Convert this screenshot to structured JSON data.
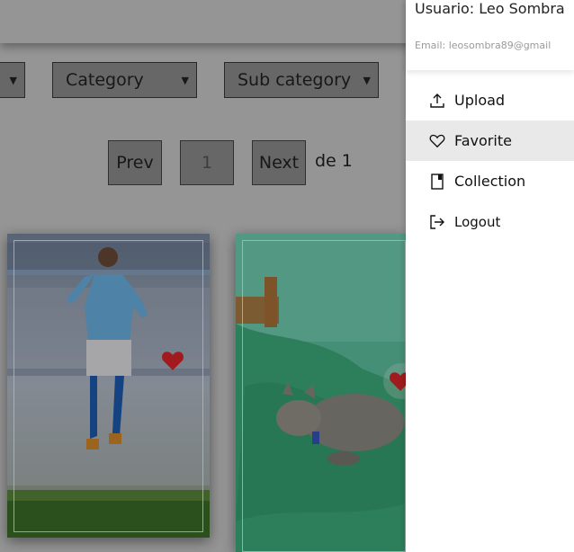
{
  "filters": {
    "first_select_value": "",
    "category_label": "Category",
    "subcategory_label": "Sub category"
  },
  "pagination": {
    "prev_label": "Prev",
    "page_number": "1",
    "next_label": "Next",
    "of_label": "de 1"
  },
  "sidebar": {
    "username": "Usuario: Leo Sombra",
    "email": "Email: leosombra89@gmail",
    "items": [
      {
        "label": "Upload",
        "icon": "upload-icon"
      },
      {
        "label": "Favorite",
        "icon": "heart-icon"
      },
      {
        "label": "Collection",
        "icon": "book-icon"
      },
      {
        "label": "Logout",
        "icon": "logout-icon"
      }
    ]
  },
  "colors": {
    "favorite_heart": "#e0262a",
    "sidebar_active_bg": "#e9e9e9"
  }
}
